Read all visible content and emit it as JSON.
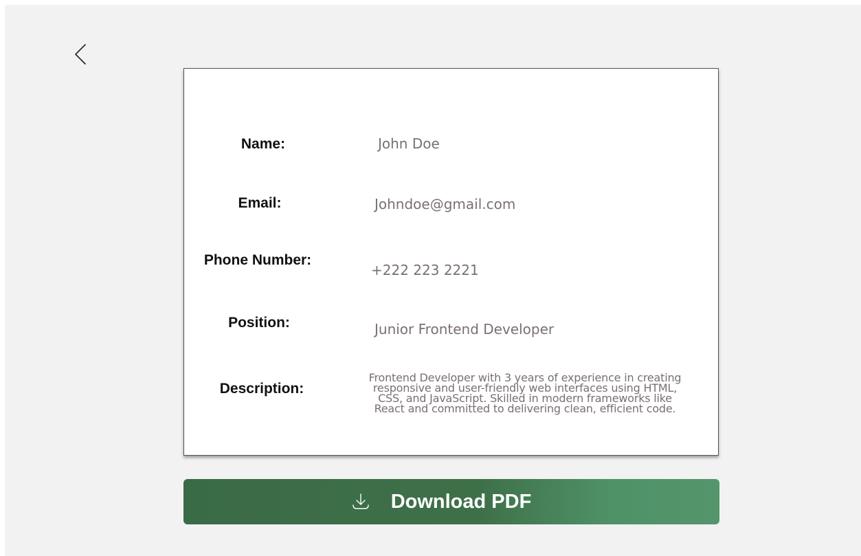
{
  "navigation": {
    "back_icon": "chevron-left-icon"
  },
  "profile": {
    "name_label": "Name:",
    "name_value": "John Doe",
    "email_label": "Email:",
    "email_value": "Johndoe@gmail.com",
    "phone_label": "Phone Number:",
    "phone_value": "+222 223 2221",
    "position_label": "Position:",
    "position_value": "Junior Frontend Developer",
    "description_label": "Description:",
    "description_lines": [
      "Frontend Developer with 3 years of experience in creating",
      "responsive and user-friendly web interfaces using HTML,",
      "CSS, and JavaScript. Skilled in modern frameworks like",
      "React and committed to delivering clean, efficient code."
    ]
  },
  "actions": {
    "download_label": "Download PDF",
    "download_icon": "download-icon"
  },
  "colors": {
    "button_green": "#3e7048",
    "value_text": "#7a6f72",
    "background": "#f2f2f2"
  }
}
